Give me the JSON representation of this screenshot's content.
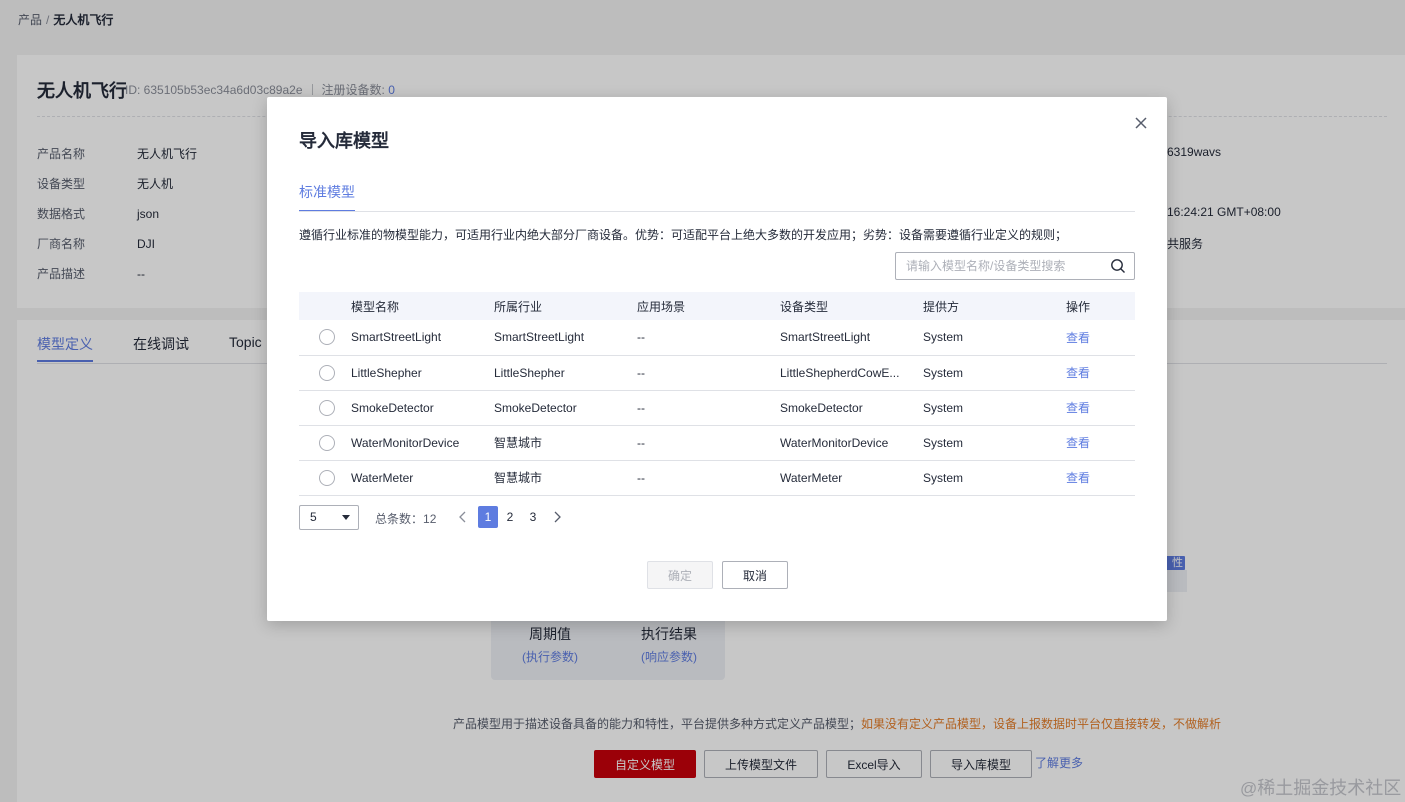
{
  "breadcrumb": {
    "root": "产品",
    "separator": "/",
    "current": "无人机飞行"
  },
  "product": {
    "title": "无人机飞行",
    "id_label": "ID: 635105b53ec34a6d03c89a2e",
    "registered_label": "注册设备数:",
    "registered_count": "0",
    "info": [
      {
        "key": "产品名称",
        "value": "无人机飞行"
      },
      {
        "key": "设备类型",
        "value": "无人机"
      },
      {
        "key": "数据格式",
        "value": "json"
      },
      {
        "key": "厂商名称",
        "value": "DJI"
      },
      {
        "key": "产品描述",
        "value": "--"
      }
    ],
    "right_fragments": [
      "6319wavs",
      "16:24:21 GMT+08:00",
      "共服务"
    ]
  },
  "detail_tabs": [
    "模型定义",
    "在线调试",
    "Topic"
  ],
  "diagram": {
    "items": [
      {
        "title": "周期值",
        "sub": "(执行参数)"
      },
      {
        "title": "执行结果",
        "sub": "(响应参数)"
      }
    ],
    "badge": "性"
  },
  "hint": {
    "normal": "产品模型用于描述设备具备的能力和特性，平台提供多种方式定义产品模型；",
    "warn": "如果没有定义产品模型，设备上报数据时平台仅直接转发，不做解析"
  },
  "actions": {
    "custom_model": "自定义模型",
    "upload_model": "上传模型文件",
    "excel_import": "Excel导入",
    "import_library": "导入库模型",
    "learn_more": "了解更多"
  },
  "modal": {
    "title": "导入库模型",
    "tab": "标准模型",
    "description": "遵循行业标准的物模型能力，可适用行业内绝大部分厂商设备。优势：可适配平台上绝大多数的开发应用；劣势：设备需要遵循行业定义的规则；",
    "search_placeholder": "请输入模型名称/设备类型搜索",
    "columns": [
      "模型名称",
      "所属行业",
      "应用场景",
      "设备类型",
      "提供方",
      "操作"
    ],
    "rows": [
      {
        "name": "SmartStreetLight",
        "industry": "SmartStreetLight",
        "scene": "--",
        "device_type": "SmartStreetLight",
        "provider": "System",
        "action": "查看"
      },
      {
        "name": "LittleShepher",
        "industry": "LittleShepher",
        "scene": "--",
        "device_type": "LittleShepherdCowE...",
        "provider": "System",
        "action": "查看"
      },
      {
        "name": "SmokeDetector",
        "industry": "SmokeDetector",
        "scene": "--",
        "device_type": "SmokeDetector",
        "provider": "System",
        "action": "查看"
      },
      {
        "name": "WaterMonitorDevice",
        "industry": "智慧城市",
        "scene": "--",
        "device_type": "WaterMonitorDevice",
        "provider": "System",
        "action": "查看"
      },
      {
        "name": "WaterMeter",
        "industry": "智慧城市",
        "scene": "--",
        "device_type": "WaterMeter",
        "provider": "System",
        "action": "查看"
      }
    ],
    "pagination": {
      "page_size": "5",
      "total_label": "总条数：",
      "total": "12",
      "pages": [
        "1",
        "2",
        "3"
      ],
      "current_page": "1"
    },
    "ok_label": "确定",
    "cancel_label": "取消"
  },
  "watermark": {
    "at": "@",
    "text": "稀土掘金技术社区"
  },
  "colors": {
    "primary": "#5e7ce0",
    "brand_red": "#c7000b",
    "warning": "#e37d29"
  }
}
